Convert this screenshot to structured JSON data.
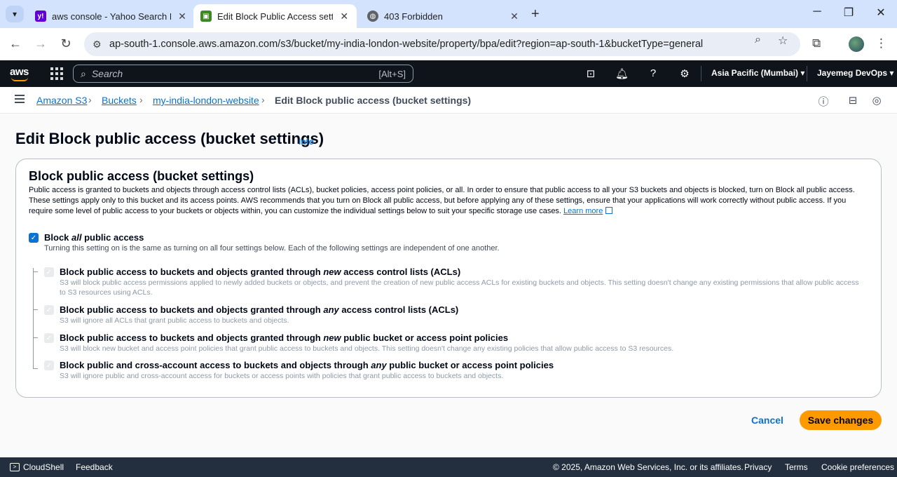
{
  "browser": {
    "tabs": [
      {
        "title": "aws console - Yahoo Search Results",
        "favicon": "Y!",
        "color": "#6001d2"
      },
      {
        "title": "Edit Block Public Access settings",
        "favicon": "S3",
        "color": "#3f8624"
      },
      {
        "title": "403 Forbidden",
        "favicon": "globe-icon",
        "color": "#5f6368"
      }
    ],
    "url": "ap-south-1.console.aws.amazon.com/s3/bucket/my-india-london-website/property/bpa/edit?region=ap-south-1&bucketType=general"
  },
  "aws_nav": {
    "logo": "aws",
    "search_placeholder": "Search",
    "search_shortcut": "[Alt+S]",
    "region": "Asia Pacific (Mumbai)",
    "user": "Jayemeg DevOps"
  },
  "breadcrumb": {
    "items": [
      "Amazon S3",
      "Buckets",
      "my-india-london-website"
    ],
    "current": "Edit Block public access (bucket settings)"
  },
  "page": {
    "title": "Edit Block public access (bucket settings)",
    "info": "Info"
  },
  "panel": {
    "title": "Block public access (bucket settings)",
    "description": "Public access is granted to buckets and objects through access control lists (ACLs), bucket policies, access point policies, or all. In order to ensure that public access to all your S3 buckets and objects is blocked, turn on Block all public access. These settings apply only to this bucket and its access points. AWS recommends that you turn on Block all public access, but before applying any of these settings, ensure that your applications will work correctly without public access. If you require some level of public access to your buckets or objects within, you can customize the individual settings below to suit your specific storage use cases.",
    "learn_more": "Learn more",
    "main_option": {
      "title_pre": "Block ",
      "title_em": "all",
      "title_post": " public access",
      "description": "Turning this setting on is the same as turning on all four settings below. Each of the following settings are independent of one another.",
      "checked": true
    },
    "options": [
      {
        "title_pre": "Block public access to buckets and objects granted through ",
        "title_em": "new",
        "title_post": " access control lists (ACLs)",
        "description": "S3 will block public access permissions applied to newly added buckets or objects, and prevent the creation of new public access ACLs for existing buckets and objects. This setting doesn't change any existing permissions that allow public access to S3 resources using ACLs.",
        "checked": true
      },
      {
        "title_pre": "Block public access to buckets and objects granted through ",
        "title_em": "any",
        "title_post": " access control lists (ACLs)",
        "description": "S3 will ignore all ACLs that grant public access to buckets and objects.",
        "checked": true
      },
      {
        "title_pre": "Block public access to buckets and objects granted through ",
        "title_em": "new",
        "title_post": " public bucket or access point policies",
        "description": "S3 will block new bucket and access point policies that grant public access to buckets and objects. This setting doesn't change any existing policies that allow public access to S3 resources.",
        "checked": true
      },
      {
        "title_pre": "Block public and cross-account access to buckets and objects through ",
        "title_em": "any",
        "title_post": " public bucket or access point policies",
        "description": "S3 will ignore public and cross-account access for buckets or access points with policies that grant public access to buckets and objects.",
        "checked": true
      }
    ]
  },
  "actions": {
    "cancel": "Cancel",
    "save": "Save changes"
  },
  "footer": {
    "cloudshell": "CloudShell",
    "feedback": "Feedback",
    "copyright": "© 2025, Amazon Web Services, Inc. or its affiliates.",
    "privacy": "Privacy",
    "terms": "Terms",
    "cookies": "Cookie preferences"
  },
  "colors": {
    "accent": "#0972d3",
    "primary_button": "#ff9900",
    "aws_nav_bg": "#0f141a",
    "footer_bg": "#232f3e"
  }
}
